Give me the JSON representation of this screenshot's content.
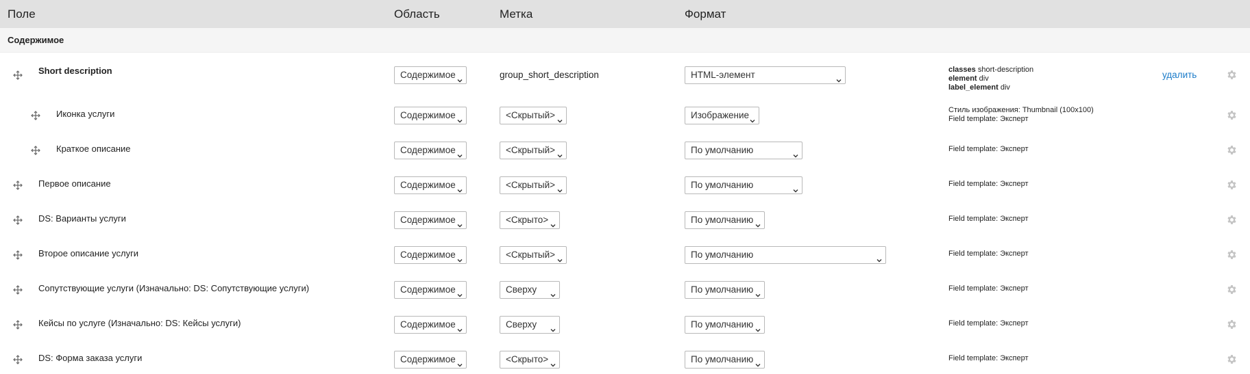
{
  "header": {
    "field": "Поле",
    "region": "Область",
    "label": "Метка",
    "format": "Формат"
  },
  "region_title": "Содержимое",
  "rows": [
    {
      "name": "Short description",
      "region": "Содержимое",
      "label_value": "group_short_description",
      "format": "HTML-элемент",
      "summary": [
        {
          "key": "classes",
          "value": "short-description"
        },
        {
          "key": "element",
          "value": "div"
        },
        {
          "key": "label_element",
          "value": "div"
        }
      ],
      "action": "удалить"
    },
    {
      "name": "Иконка услуги",
      "region": "Содержимое",
      "label_value": "<Скрытый>",
      "format": "Изображение",
      "summary_lines": [
        "Стиль изображения: Thumbnail (100x100)",
        "Field template: Эксперт"
      ]
    },
    {
      "name": "Краткое описание",
      "region": "Содержимое",
      "label_value": "<Скрытый>",
      "format": "По умолчанию",
      "summary_lines": [
        "Field template: Эксперт"
      ]
    },
    {
      "name": "Первое описание",
      "region": "Содержимое",
      "label_value": "<Скрытый>",
      "format": "По умолчанию",
      "summary_lines": [
        "Field template: Эксперт"
      ]
    },
    {
      "name": "DS: Варианты услуги",
      "region": "Содержимое",
      "label_value": "<Скрыто>",
      "format": "По умолчанию",
      "summary_lines": [
        "Field template: Эксперт"
      ]
    },
    {
      "name": "Второе описание услуги",
      "region": "Содержимое",
      "label_value": "<Скрытый>",
      "format": "По умолчанию",
      "summary_lines": [
        "Field template: Эксперт"
      ]
    },
    {
      "name": "Сопутствующие услуги (Изначально: DS: Сопутствующие услуги)",
      "region": "Содержимое",
      "label_value": "Сверху",
      "format": "По умолчанию",
      "summary_lines": [
        "Field template: Эксперт"
      ]
    },
    {
      "name": "Кейсы по услуге (Изначально: DS: Кейсы услуги)",
      "region": "Содержимое",
      "label_value": "Сверху",
      "format": "По умолчанию",
      "summary_lines": [
        "Field template: Эксперт"
      ]
    },
    {
      "name": "DS: Форма заказа услуги",
      "region": "Содержимое",
      "label_value": "<Скрыто>",
      "format": "По умолчанию",
      "summary_lines": [
        "Field template: Эксперт"
      ]
    }
  ],
  "icons": {
    "drag": "move-arrows-icon",
    "settings": "gear-icon",
    "dropdown": "chevron-down-icon"
  },
  "colors": {
    "header_bg": "#e1e1e1",
    "link": "#1a7bc9",
    "gear": "#c4c4c4"
  }
}
